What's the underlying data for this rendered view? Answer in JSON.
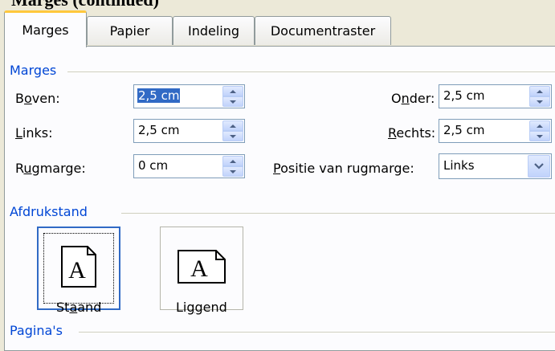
{
  "tabs": [
    {
      "label": "Marges"
    },
    {
      "label": "Papier"
    },
    {
      "label": "Indeling"
    },
    {
      "label": "Documentraster"
    }
  ],
  "margins_group": {
    "title": "Marges",
    "boven": {
      "label": "Boven:",
      "value": "2,5 cm"
    },
    "links": {
      "label": "Links:",
      "value": "2,5 cm"
    },
    "rugmarge": {
      "label": "Rugmarge:",
      "value": "0 cm"
    },
    "onder": {
      "label": "Onder:",
      "value": "2,5 cm"
    },
    "rechts": {
      "label": "Rechts:",
      "value": "2,5 cm"
    },
    "positie": {
      "label": "Positie van rugmarge:",
      "value": "Links"
    }
  },
  "orientation_group": {
    "title": "Afdrukstand",
    "options": [
      {
        "label": "Staand",
        "selected": true,
        "glyph": "A"
      },
      {
        "label": "Liggend",
        "selected": false,
        "glyph": "A"
      }
    ]
  },
  "pages_group": {
    "title": "Pagina's"
  },
  "colors": {
    "accent": "#316ac5",
    "group_title": "#0046d5",
    "tab_highlight": "#ffc83c"
  }
}
